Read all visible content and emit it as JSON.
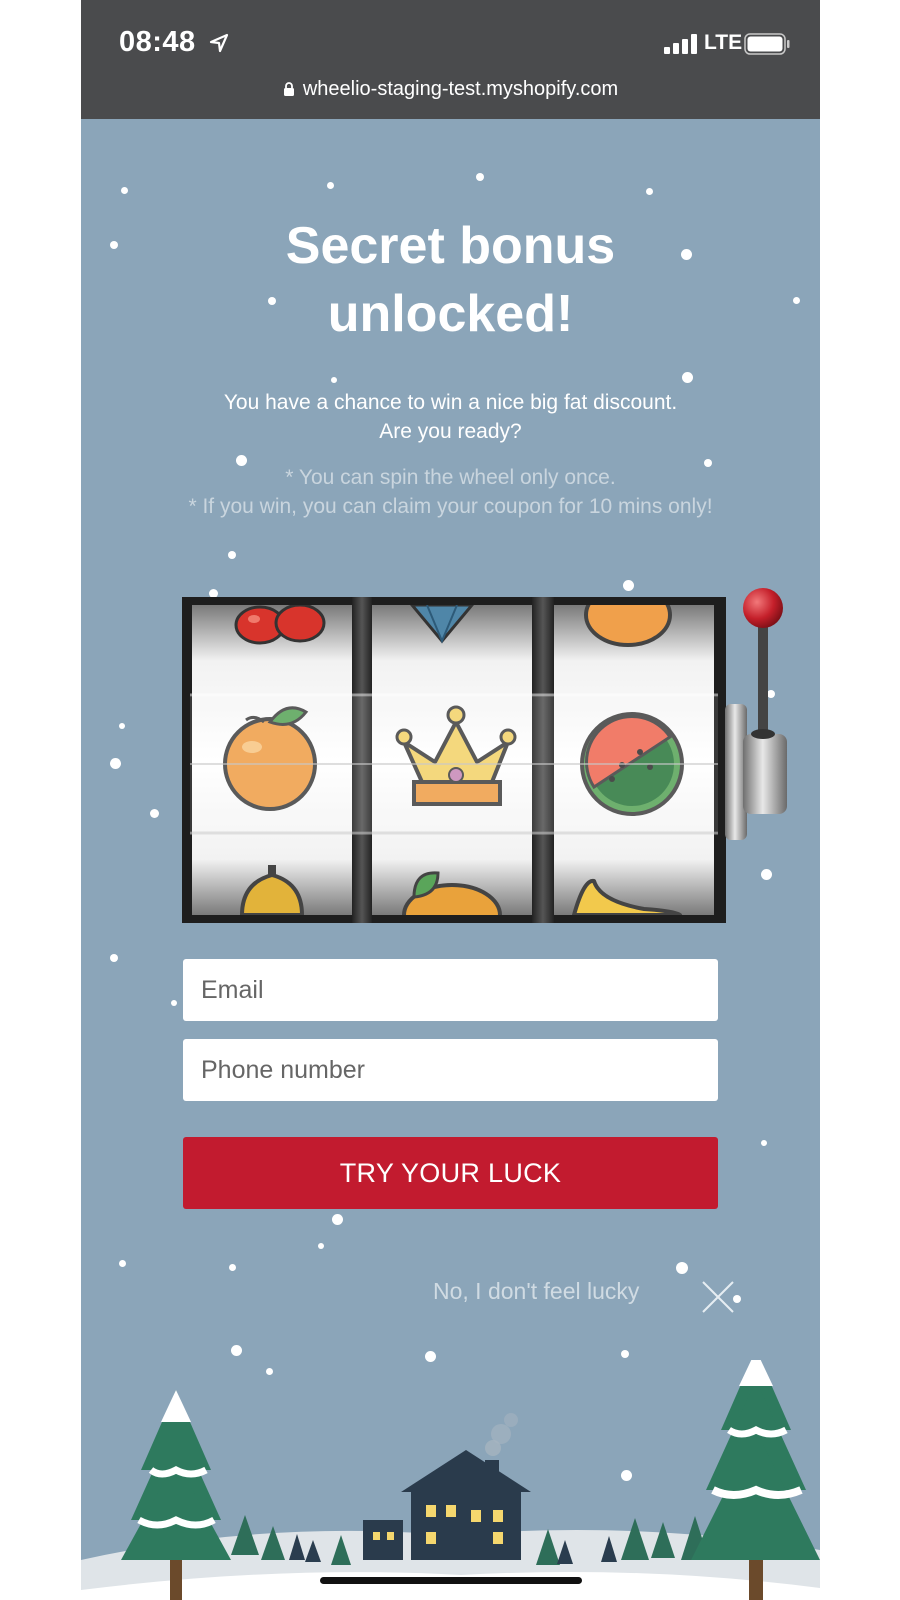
{
  "status": {
    "time": "08:48",
    "network": "LTE",
    "url": "wheelio-staging-test.myshopify.com"
  },
  "popup": {
    "title_line1": "Secret bonus",
    "title_line2": "unlocked!",
    "subtitle_line1": "You have a chance to win a nice big fat discount.",
    "subtitle_line2": "Are you ready?",
    "note1": "* You can spin the wheel only once.",
    "note2": "* If you win, you can claim your coupon for 10 mins only!",
    "email_placeholder": "Email",
    "phone_placeholder": "Phone number",
    "cta_label": "TRY YOUR LUCK",
    "decline_label": "No, I don't feel lucky"
  },
  "slot_machine": {
    "reels": [
      [
        "cherries",
        "orange",
        "lemon"
      ],
      [
        "diamond",
        "crown",
        "mango"
      ],
      [
        "orange",
        "watermelon",
        "banana"
      ]
    ]
  },
  "colors": {
    "background": "#8ba5b9",
    "status_bar": "#4a4b4d",
    "cta": "#c21b2f"
  },
  "icons": [
    "location-arrow-icon",
    "signal-icon",
    "battery-icon",
    "lock-icon",
    "close-icon"
  ]
}
